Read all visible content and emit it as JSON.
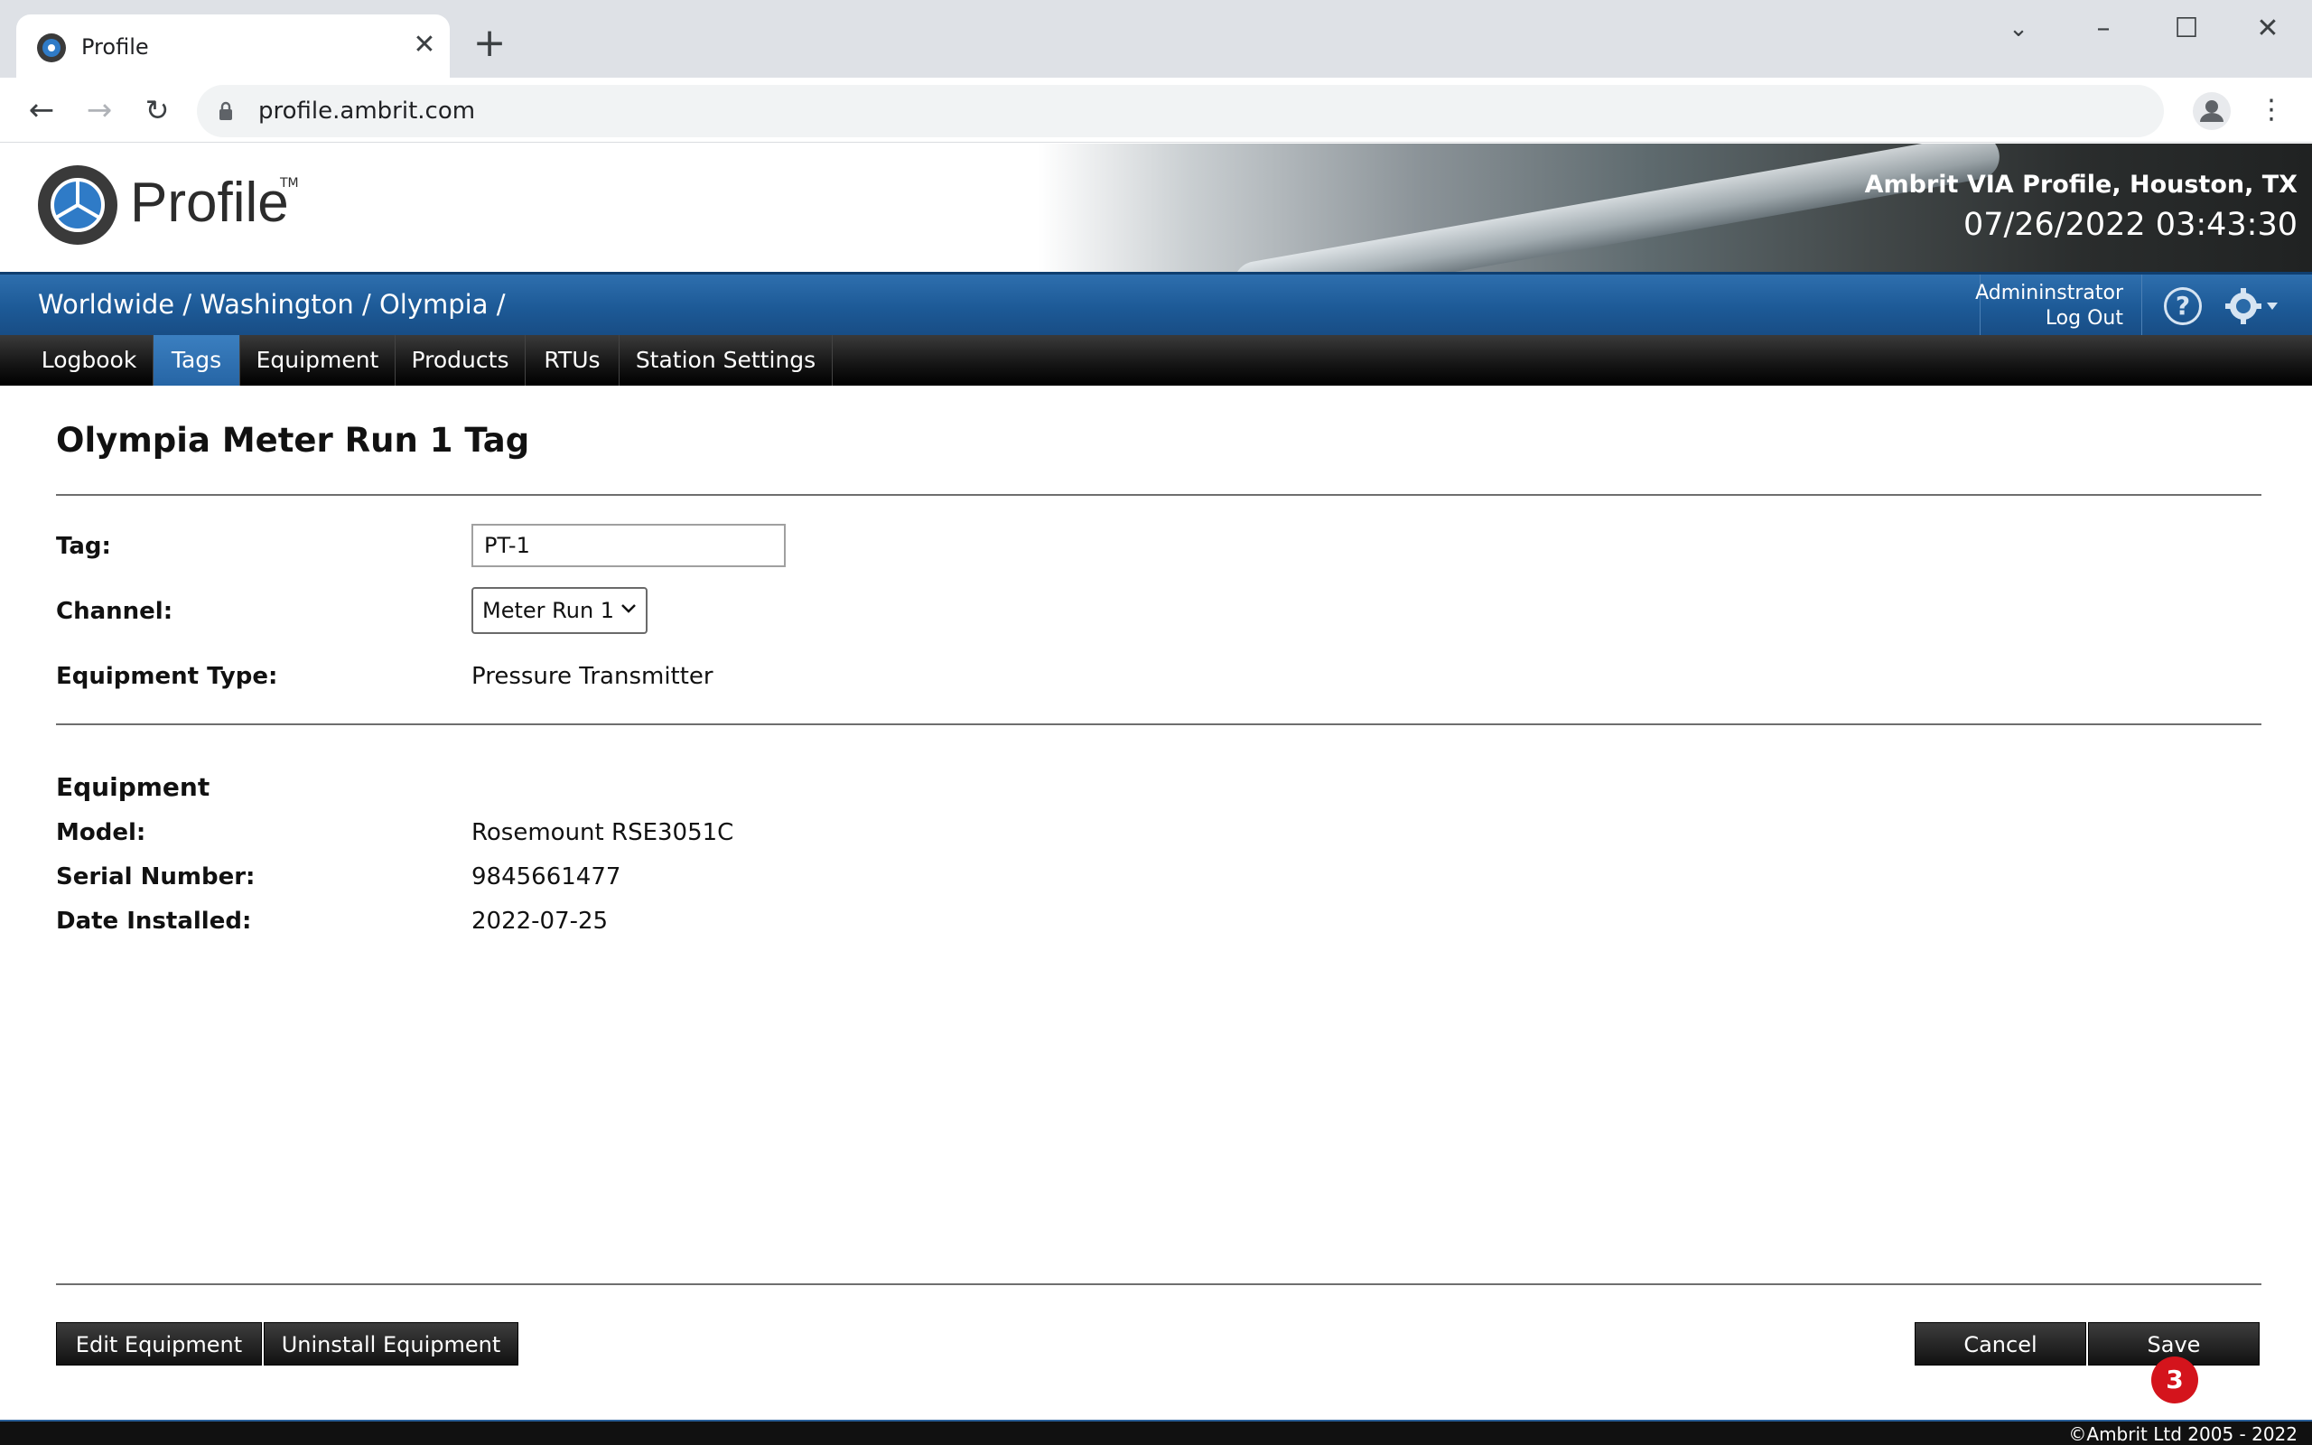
{
  "browser": {
    "tab_title": "Profile",
    "tab_close_icon": "close-icon",
    "new_tab_icon": "plus-icon",
    "url": "profile.ambrit.com"
  },
  "header": {
    "logo_text": "Profile",
    "logo_tm": "TM",
    "site_title": "Ambrit VIA Profile, Houston, TX",
    "clock": "07/26/2022 03:43:30"
  },
  "breadcrumb": {
    "text": "Worldwide / Washington / Olympia /"
  },
  "user": {
    "name": "Admininstrator",
    "logout": "Log Out",
    "help": "?"
  },
  "nav": {
    "tabs": [
      {
        "label": "Logbook",
        "active": false
      },
      {
        "label": "Tags",
        "active": true
      },
      {
        "label": "Equipment",
        "active": false
      },
      {
        "label": "Products",
        "active": false
      },
      {
        "label": "RTUs",
        "active": false
      },
      {
        "label": "Station Settings",
        "active": false
      }
    ]
  },
  "page": {
    "title": "Olympia Meter Run 1 Tag"
  },
  "form": {
    "tag_label": "Tag:",
    "tag_value": "PT-1",
    "channel_label": "Channel:",
    "channel_value": "Meter Run 1",
    "equipment_type_label": "Equipment Type:",
    "equipment_type_value": "Pressure Transmitter"
  },
  "equipment": {
    "section_title": "Equipment",
    "model_label": "Model:",
    "model_value": "Rosemount RSE3051C",
    "serial_label": "Serial Number:",
    "serial_value": "9845661477",
    "installed_label": "Date Installed:",
    "installed_value": "2022-07-25"
  },
  "buttons": {
    "edit": "Edit Equipment",
    "uninstall": "Uninstall Equipment",
    "cancel": "Cancel",
    "save": "Save"
  },
  "badge": {
    "count": "3"
  },
  "footer": {
    "copyright": "©Ambrit Ltd 2005 - 2022"
  },
  "colors": {
    "breadcrumb_blue": "#1d5a97",
    "active_tab_blue": "#2665a5",
    "badge_red": "#d4141c"
  }
}
